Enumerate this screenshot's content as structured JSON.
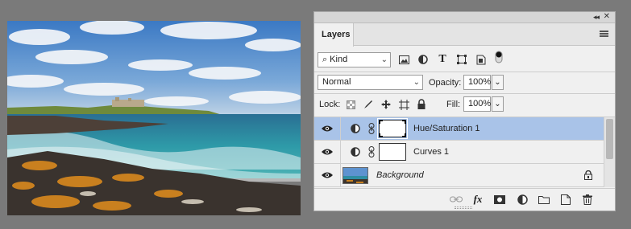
{
  "panel": {
    "collapse_glyph": "◂◂",
    "close_glyph": "✕",
    "tab_label": "Layers"
  },
  "filter": {
    "kind_label": "Kind",
    "icons": [
      "image-filter-icon",
      "adjustment-filter-icon",
      "type-filter-icon",
      "shape-filter-icon",
      "smart-object-filter-icon",
      "filter-toggle-icon"
    ]
  },
  "blend": {
    "mode": "Normal",
    "opacity_label": "Opacity:",
    "opacity_value": "100%"
  },
  "lock": {
    "label": "Lock:",
    "fill_label": "Fill:",
    "fill_value": "100%"
  },
  "layers": [
    {
      "name": "Hue/Saturation 1",
      "type": "adjustment",
      "selected": true
    },
    {
      "name": "Curves 1",
      "type": "adjustment",
      "selected": false
    },
    {
      "name": "Background",
      "type": "image",
      "selected": false,
      "locked": true
    }
  ],
  "footer": {
    "fx_label": "fx",
    "buttons": [
      "link-layers-icon",
      "fx-icon",
      "add-mask-icon",
      "new-adjustment-icon",
      "new-group-icon",
      "new-layer-icon",
      "delete-layer-icon"
    ]
  },
  "colors": {
    "selected_row": "#a9c3e8",
    "panel_bg": "#f0f0f0",
    "workspace_bg": "#7a7a7a"
  }
}
